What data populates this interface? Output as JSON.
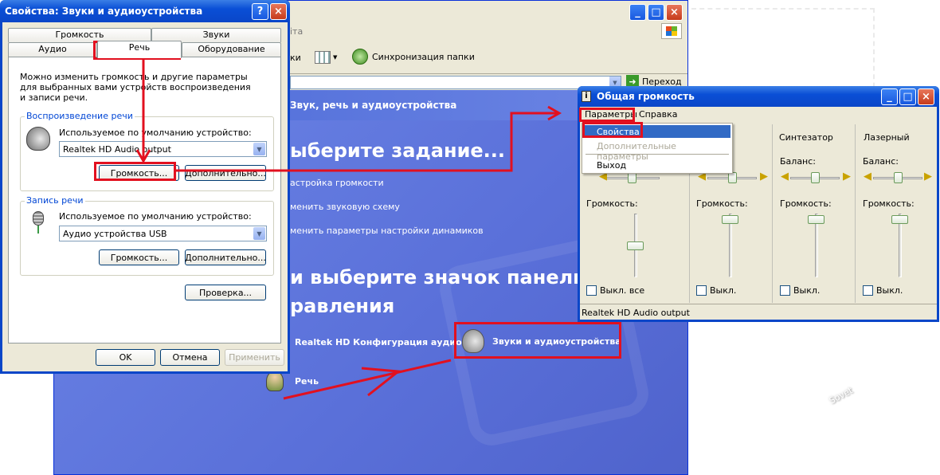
{
  "back_window": {
    "toolbar_sync": "Синхронизация папки",
    "toolbar_frag": "ки",
    "go_label": "Переход",
    "addr_frag": "іта",
    "header_title": "Звук, речь и аудиоустройства",
    "pick_task": "ыберите задание...",
    "tasks": [
      "астройка громкости",
      "менить звуковую схему",
      "менить параметры настройки динамиков"
    ],
    "pick_icon_line1": "и выберите значок панели",
    "pick_icon_line2": "равления",
    "item_realtek": "Realtek HD Конфигурация аудио",
    "item_sounds": "Звуки и аудиоустройства",
    "item_speech": "Речь"
  },
  "props": {
    "title": "Свойства: Звуки и аудиоустройства",
    "tabs_top": [
      "Громкость",
      "Звуки"
    ],
    "tabs_bottom": [
      "Аудио",
      "Речь",
      "Оборудование"
    ],
    "desc": "Можно изменить громкость и другие параметры для выбранных вами устройств воспроизведения и записи речи.",
    "playback_group": "Воспроизведение речи",
    "default_device_label": "Используемое по умолчанию устройство:",
    "playback_device": "Realtek HD Audio output",
    "volume_btn": "Громкость...",
    "advanced_btn": "Дополнительно...",
    "record_group": "Запись речи",
    "record_device": "Аудио устройства USB",
    "test_btn": "Проверка...",
    "ok": "OK",
    "cancel": "Отмена",
    "apply": "Применить"
  },
  "mixer": {
    "title": "Общая громкость",
    "menu": [
      "Параметры",
      "Справка"
    ],
    "dropdown": [
      "Свойства",
      "Дополнительные параметры",
      "Выход"
    ],
    "columns": [
      "",
      "",
      "Синтезатор",
      "Лазерный"
    ],
    "balance": "Баланс:",
    "volume": "Громкость:",
    "mute_all": "Выкл. все",
    "mute": "Выкл.",
    "status": "Realtek HD Audio output"
  },
  "watermark": "Sovet"
}
